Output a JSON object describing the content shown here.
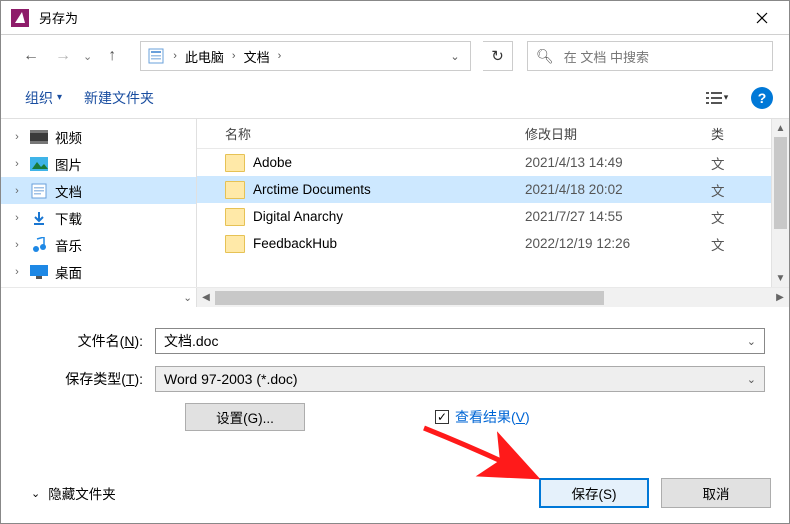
{
  "window": {
    "title": "另存为"
  },
  "nav": {
    "crumb1": "此电脑",
    "crumb2": "文档",
    "search_placeholder": "在 文档 中搜索"
  },
  "toolbar": {
    "organize": "组织",
    "new_folder": "新建文件夹"
  },
  "sidebar": {
    "items": [
      {
        "label": "视频"
      },
      {
        "label": "图片"
      },
      {
        "label": "文档"
      },
      {
        "label": "下载"
      },
      {
        "label": "音乐"
      },
      {
        "label": "桌面"
      }
    ]
  },
  "columns": {
    "name": "名称",
    "date": "修改日期",
    "type": "类"
  },
  "rows": [
    {
      "name": "Adobe",
      "date": "2021/4/13 14:49",
      "type": "文"
    },
    {
      "name": "Arctime Documents",
      "date": "2021/4/18 20:02",
      "type": "文"
    },
    {
      "name": "Digital Anarchy",
      "date": "2021/7/27 14:55",
      "type": "文"
    },
    {
      "name": "FeedbackHub",
      "date": "2022/12/19 12:26",
      "type": "文"
    }
  ],
  "form": {
    "filename_label_pre": "文件名(",
    "filename_label_u": "N",
    "filename_label_post": "):",
    "filename_value": "文档.doc",
    "filetype_label_pre": "保存类型(",
    "filetype_label_u": "T",
    "filetype_label_post": "):",
    "filetype_value": "Word 97-2003 (*.doc)",
    "settings_label": "设置(G)...",
    "view_result_pre": "查看结果(",
    "view_result_u": "V",
    "view_result_post": ")",
    "checkbox_mark": "✓"
  },
  "footer": {
    "hide_folders": "隐藏文件夹",
    "save_label": "保存(S)",
    "cancel_label": "取消"
  }
}
